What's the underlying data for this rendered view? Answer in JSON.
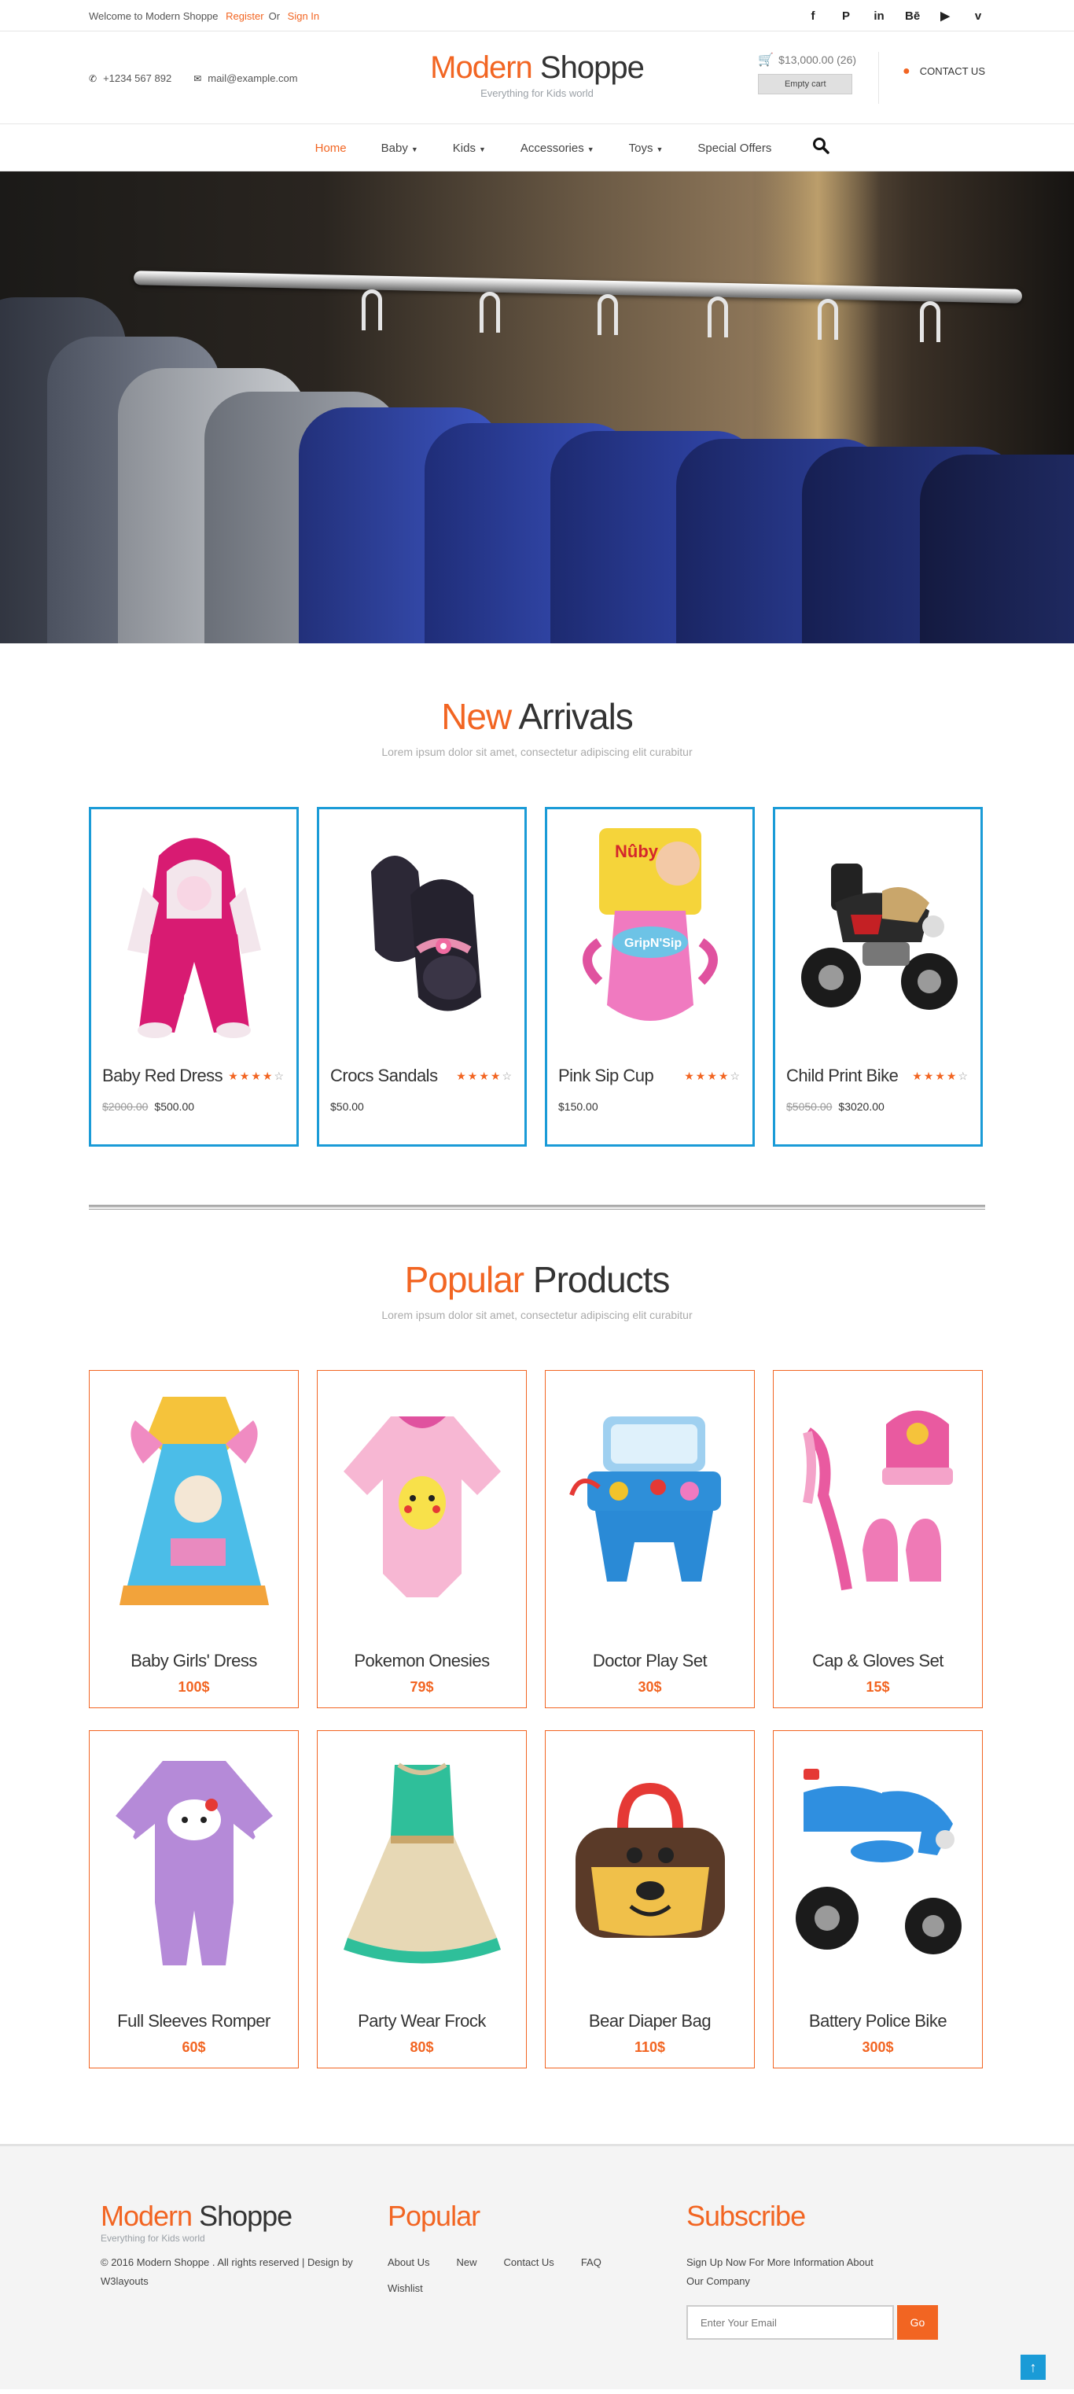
{
  "topbar": {
    "welcome": "Welcome to Modern Shoppe",
    "register": "Register",
    "or": "Or",
    "signin": "Sign In",
    "social": [
      "facebook-icon",
      "pinterest-icon",
      "linkedin-icon",
      "behance-icon",
      "youtube-icon",
      "vimeo-icon"
    ],
    "social_glyphs": [
      "f",
      "P",
      "in",
      "Bē",
      "▶",
      "v"
    ]
  },
  "header": {
    "phone": "+1234 567 892",
    "email": "mail@example.com",
    "logo_part1": "Modern",
    "logo_part2": "Shoppe",
    "tagline": "Everything for Kids world",
    "cart_total": "$13,000.00 (26)",
    "empty_cart": "Empty cart",
    "contact": "CONTACT US"
  },
  "nav": {
    "items": [
      {
        "label": "Home",
        "dropdown": false
      },
      {
        "label": "Baby",
        "dropdown": true
      },
      {
        "label": "Kids",
        "dropdown": true
      },
      {
        "label": "Accessories",
        "dropdown": true
      },
      {
        "label": "Toys",
        "dropdown": true
      },
      {
        "label": "Special Offers",
        "dropdown": false
      }
    ]
  },
  "arrivals": {
    "title_part1": "New",
    "title_part2": "Arrivals",
    "subtitle": "Lorem ipsum dolor sit amet, consectetur adipiscing elit curabitur",
    "products": [
      {
        "name": "Baby Red Dress",
        "old_price": "$2000.00",
        "price": "$500.00",
        "rating": 4
      },
      {
        "name": "Crocs Sandals",
        "old_price": "",
        "price": "$50.00",
        "rating": 4
      },
      {
        "name": "Pink Sip Cup",
        "old_price": "",
        "price": "$150.00",
        "rating": 4
      },
      {
        "name": "Child Print Bike",
        "old_price": "$5050.00",
        "price": "$3020.00",
        "rating": 4
      }
    ]
  },
  "popular": {
    "title_part1": "Popular",
    "title_part2": "Products",
    "subtitle": "Lorem ipsum dolor sit amet, consectetur adipiscing elit curabitur",
    "products": [
      {
        "name": "Baby Girls' Dress",
        "price": "100$"
      },
      {
        "name": "Pokemon Onesies",
        "price": "79$"
      },
      {
        "name": "Doctor Play Set",
        "price": "30$"
      },
      {
        "name": "Cap & Gloves Set",
        "price": "15$"
      },
      {
        "name": "Full Sleeves Romper",
        "price": "60$"
      },
      {
        "name": "Party Wear Frock",
        "price": "80$"
      },
      {
        "name": "Bear Diaper Bag",
        "price": "110$"
      },
      {
        "name": "Battery Police Bike",
        "price": "300$"
      }
    ]
  },
  "footer": {
    "logo_part1": "Modern",
    "logo_part2": "Shoppe",
    "tagline": "Everything for Kids world",
    "copyright": "© 2016 Modern Shoppe . All rights reserved | Design by W3layouts",
    "popular_heading": "Popular",
    "links": [
      "About Us",
      "New",
      "Contact Us",
      "FAQ",
      "Wishlist"
    ],
    "subscribe_heading": "Subscribe",
    "subscribe_text": "Sign Up Now For More Information About Our Company",
    "email_placeholder": "Enter Your Email",
    "go": "Go"
  },
  "colors": {
    "accent": "#f26522",
    "card_border_blue": "#1a9bd7",
    "card_border_orange": "#f26522"
  }
}
